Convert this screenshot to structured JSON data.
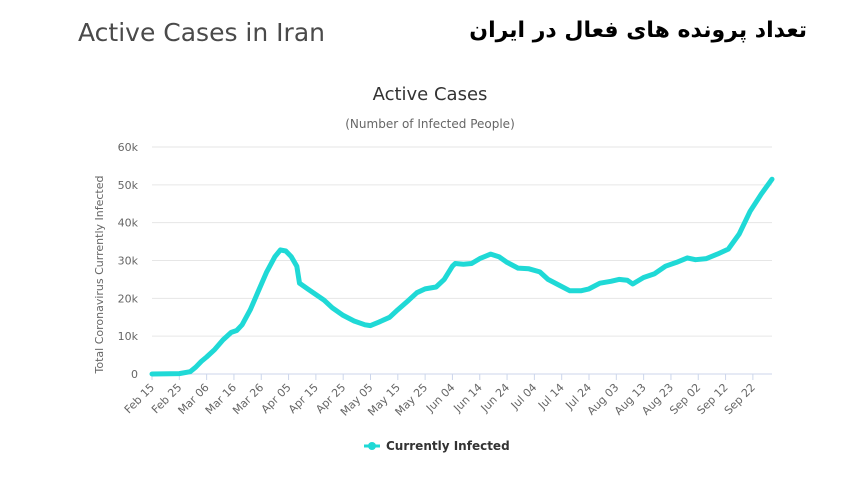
{
  "header": {
    "title": "Active Cases in Iran",
    "persian_title": "تعداد پرونده های فعال در ایران"
  },
  "colors": {
    "series": "#1fd9d6",
    "grid": "#e6e6e6",
    "axis": "#ccd6eb"
  },
  "chart_data": {
    "type": "line",
    "title": "Active Cases",
    "subtitle": "(Number of Infected People)",
    "xlabel": "",
    "ylabel": "Total Coronavirus Currently Infected",
    "ylim": [
      0,
      60000
    ],
    "yticks": [
      0,
      10000,
      20000,
      30000,
      40000,
      50000,
      60000
    ],
    "ytick_labels": [
      "0",
      "10k",
      "20k",
      "30k",
      "40k",
      "50k",
      "60k"
    ],
    "xtick_labels": [
      "Feb 15",
      "Feb 25",
      "Mar 06",
      "Mar 16",
      "Mar 26",
      "Apr 05",
      "Apr 15",
      "Apr 25",
      "May 05",
      "May 15",
      "May 25",
      "Jun 04",
      "Jun 14",
      "Jun 24",
      "Jul 04",
      "Jul 14",
      "Jul 24",
      "Aug 03",
      "Aug 13",
      "Aug 23",
      "Sep 02",
      "Sep 12",
      "Sep 22"
    ],
    "grid": true,
    "legend": "bottom-center",
    "series": [
      {
        "name": "Currently Infected",
        "points": [
          [
            "Feb 15",
            0
          ],
          [
            "Feb 25",
            100
          ],
          [
            "Feb 29",
            600
          ],
          [
            "Mar 02",
            1800
          ],
          [
            "Mar 04",
            3300
          ],
          [
            "Mar 06",
            4500
          ],
          [
            "Mar 09",
            6500
          ],
          [
            "Mar 12",
            9000
          ],
          [
            "Mar 15",
            11000
          ],
          [
            "Mar 17",
            11500
          ],
          [
            "Mar 19",
            13000
          ],
          [
            "Mar 22",
            17000
          ],
          [
            "Mar 25",
            22000
          ],
          [
            "Mar 28",
            27000
          ],
          [
            "Mar 31",
            31000
          ],
          [
            "Apr 02",
            32800
          ],
          [
            "Apr 04",
            32500
          ],
          [
            "Apr 06",
            31000
          ],
          [
            "Apr 08",
            28500
          ],
          [
            "Apr 09",
            24000
          ],
          [
            "Apr 12",
            22500
          ],
          [
            "Apr 15",
            21000
          ],
          [
            "Apr 18",
            19500
          ],
          [
            "Apr 21",
            17500
          ],
          [
            "Apr 25",
            15500
          ],
          [
            "Apr 29",
            14000
          ],
          [
            "May 03",
            13000
          ],
          [
            "May 05",
            12800
          ],
          [
            "May 08",
            13700
          ],
          [
            "May 12",
            15000
          ],
          [
            "May 15",
            17000
          ],
          [
            "May 19",
            19500
          ],
          [
            "May 22",
            21500
          ],
          [
            "May 25",
            22500
          ],
          [
            "May 29",
            23000
          ],
          [
            "Jun 01",
            25000
          ],
          [
            "Jun 04",
            28500
          ],
          [
            "Jun 05",
            29200
          ],
          [
            "Jun 08",
            29000
          ],
          [
            "Jun 11",
            29200
          ],
          [
            "Jun 14",
            30500
          ],
          [
            "Jun 18",
            31700
          ],
          [
            "Jun 21",
            31000
          ],
          [
            "Jun 24",
            29500
          ],
          [
            "Jun 28",
            28000
          ],
          [
            "Jul 02",
            27800
          ],
          [
            "Jul 06",
            27000
          ],
          [
            "Jul 09",
            25000
          ],
          [
            "Jul 13",
            23500
          ],
          [
            "Jul 17",
            22000
          ],
          [
            "Jul 21",
            22000
          ],
          [
            "Jul 24",
            22500
          ],
          [
            "Jul 28",
            24000
          ],
          [
            "Aug 01",
            24500
          ],
          [
            "Aug 04",
            25000
          ],
          [
            "Aug 07",
            24800
          ],
          [
            "Aug 09",
            23800
          ],
          [
            "Aug 13",
            25500
          ],
          [
            "Aug 17",
            26500
          ],
          [
            "Aug 21",
            28500
          ],
          [
            "Aug 25",
            29500
          ],
          [
            "Aug 29",
            30700
          ],
          [
            "Sep 01",
            30200
          ],
          [
            "Sep 05",
            30500
          ],
          [
            "Sep 09",
            31700
          ],
          [
            "Sep 13",
            33000
          ],
          [
            "Sep 17",
            37000
          ],
          [
            "Sep 21",
            43000
          ],
          [
            "Sep 25",
            47500
          ],
          [
            "Sep 29",
            51500
          ]
        ]
      }
    ]
  }
}
